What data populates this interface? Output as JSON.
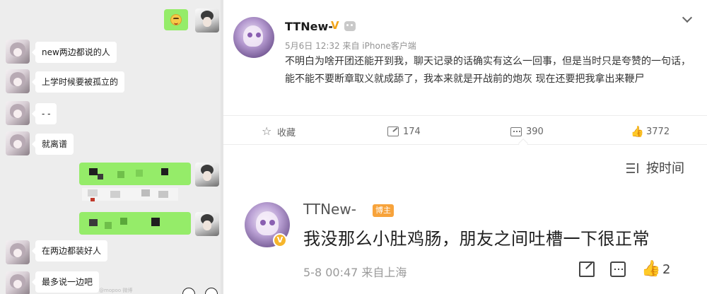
{
  "chat": {
    "messages": [
      {
        "side": "left",
        "text": "new两边都说的人"
      },
      {
        "side": "left",
        "text": "上学时候要被孤立的"
      },
      {
        "side": "left",
        "text": "- -"
      },
      {
        "side": "left",
        "text": "就离谱"
      },
      {
        "side": "left",
        "text": "在两边都装好人"
      },
      {
        "side": "left",
        "text": "最多说一边吧"
      }
    ],
    "watermark": "@mopoo 微博"
  },
  "post": {
    "author": "TTNew-",
    "vip_icon": "V",
    "meta": "5月6日 12:32 来自 iPhone客户端",
    "body": "不明白为啥开团还能开到我，聊天记录的话确实有这么一回事，但是当时只是夸赞的一句话，能不能不要断章取义就成舔了，我本来就是开战前的炮灰 现在还要把我拿出来鞭尸",
    "actions": {
      "favorite_label": "收藏",
      "share_count": "174",
      "comment_count": "390",
      "like_count": "3772"
    }
  },
  "comments": {
    "sort_label": "按时间",
    "items": [
      {
        "author": "TTNew-",
        "badge": "博主",
        "text": "我没那么小肚鸡肠，朋友之间吐槽一下很正常",
        "meta": "5-8 00:47 来自上海",
        "like_count": "2"
      }
    ]
  },
  "colors": {
    "chat_bg": "#ededed",
    "bubble_green": "#95ec69",
    "vip_orange": "#f3a61c",
    "tag_orange": "#f7a33b"
  }
}
